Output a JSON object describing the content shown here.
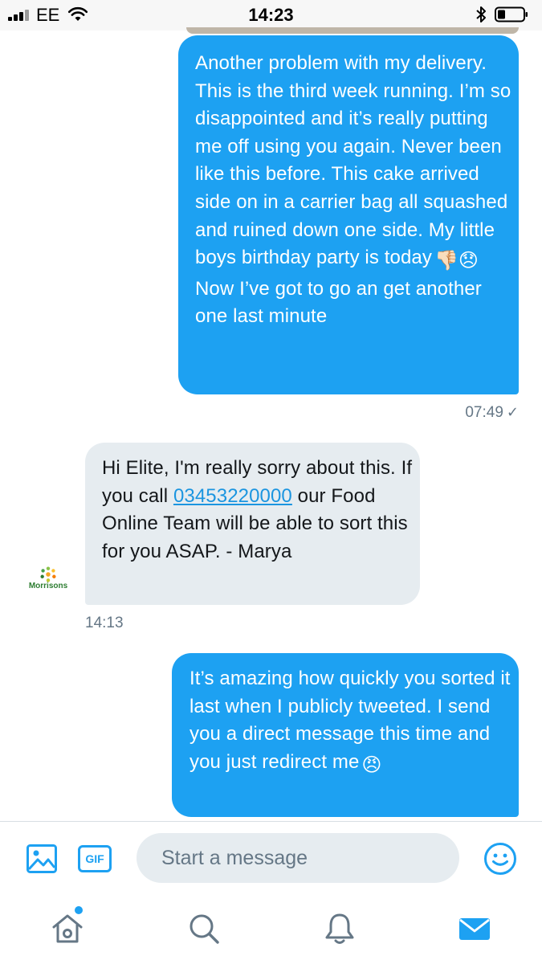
{
  "status_bar": {
    "carrier": "EE",
    "time": "14:23"
  },
  "conversation": {
    "messages": [
      {
        "direction": "outgoing",
        "text": "Another problem with my delivery. This is the third week running. I’m so disappointed and it’s really putting me off using you again. Never been like this before. This cake arrived side on in a carrier bag all squashed and ruined down one side. My little boys birthday party is today",
        "emoji_inline": "👎🏻😞",
        "text_after": "Now I’ve got to go an get another one last minute",
        "time": "07:49",
        "status_icon": "sent-check-icon"
      },
      {
        "direction": "incoming",
        "text_before": "Hi Elite, I'm really sorry about this. If you call ",
        "phone": "03453220000",
        "text_after": " our Food Online Team will be able to sort this for you ASAP. - Marya",
        "time": "14:13",
        "sender_avatar": "Morrisons"
      },
      {
        "direction": "outgoing",
        "text": "It’s amazing how quickly you sorted it last when I publicly tweeted. I send you a direct message this time and you just redirect me",
        "emoji_inline": "😠"
      }
    ]
  },
  "composer": {
    "placeholder": "Start a message",
    "gif_label": "GIF",
    "media_icon": "image-icon",
    "emoji_icon": "smiley-icon"
  },
  "tabs": [
    {
      "name": "home",
      "icon": "home-icon",
      "has_badge": true
    },
    {
      "name": "search",
      "icon": "search-icon"
    },
    {
      "name": "notifications",
      "icon": "bell-icon"
    },
    {
      "name": "messages",
      "icon": "envelope-icon",
      "active": true
    }
  ],
  "colors": {
    "accent": "#1da1f2",
    "incoming_bubble": "#e6ecf0",
    "meta_text": "#657786"
  }
}
